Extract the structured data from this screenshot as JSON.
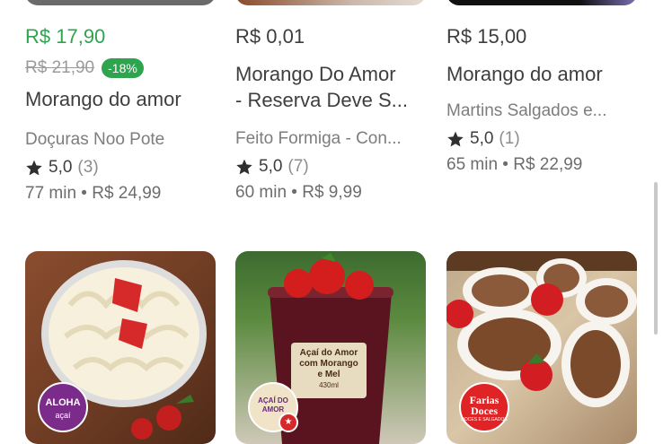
{
  "products": [
    {
      "price": "R$ 17,90",
      "old_price": "R$ 21,90",
      "discount": "-18%",
      "title": "Morango do amor",
      "store": "Doçuras Noo Pote",
      "rating": "5,0",
      "rating_count": "(3)",
      "delivery": "77 min • R$ 24,99"
    },
    {
      "price": "R$ 0,01",
      "title": "Morango Do Amor\n- Reserva Deve S...",
      "store": "Feito Formiga - Con...",
      "rating": "5,0",
      "rating_count": "(7)",
      "delivery": "60 min • R$ 9,99"
    },
    {
      "price": "R$ 15,00",
      "title": "Morango do amor",
      "store": "Martins Salgados e...",
      "rating": "5,0",
      "rating_count": "(1)",
      "delivery": "65 min • R$ 22,99"
    }
  ],
  "photo_cards": [
    {
      "logo_text": "ALOHA",
      "logo_sub": "açaí"
    },
    {
      "cup_label": "Açaí do Amor com Morango e Mel",
      "cup_volume": "430ml",
      "logo_text": "AÇAÍ DO AMOR"
    },
    {
      "logo_text": "Farias Doces",
      "logo_sub": "DOCES E SALGADOS"
    }
  ],
  "icons": {
    "rating": "star-icon"
  },
  "colors": {
    "discount": "#2ea44f",
    "text": "#3e3e3e",
    "muted": "#7d7d7d"
  }
}
